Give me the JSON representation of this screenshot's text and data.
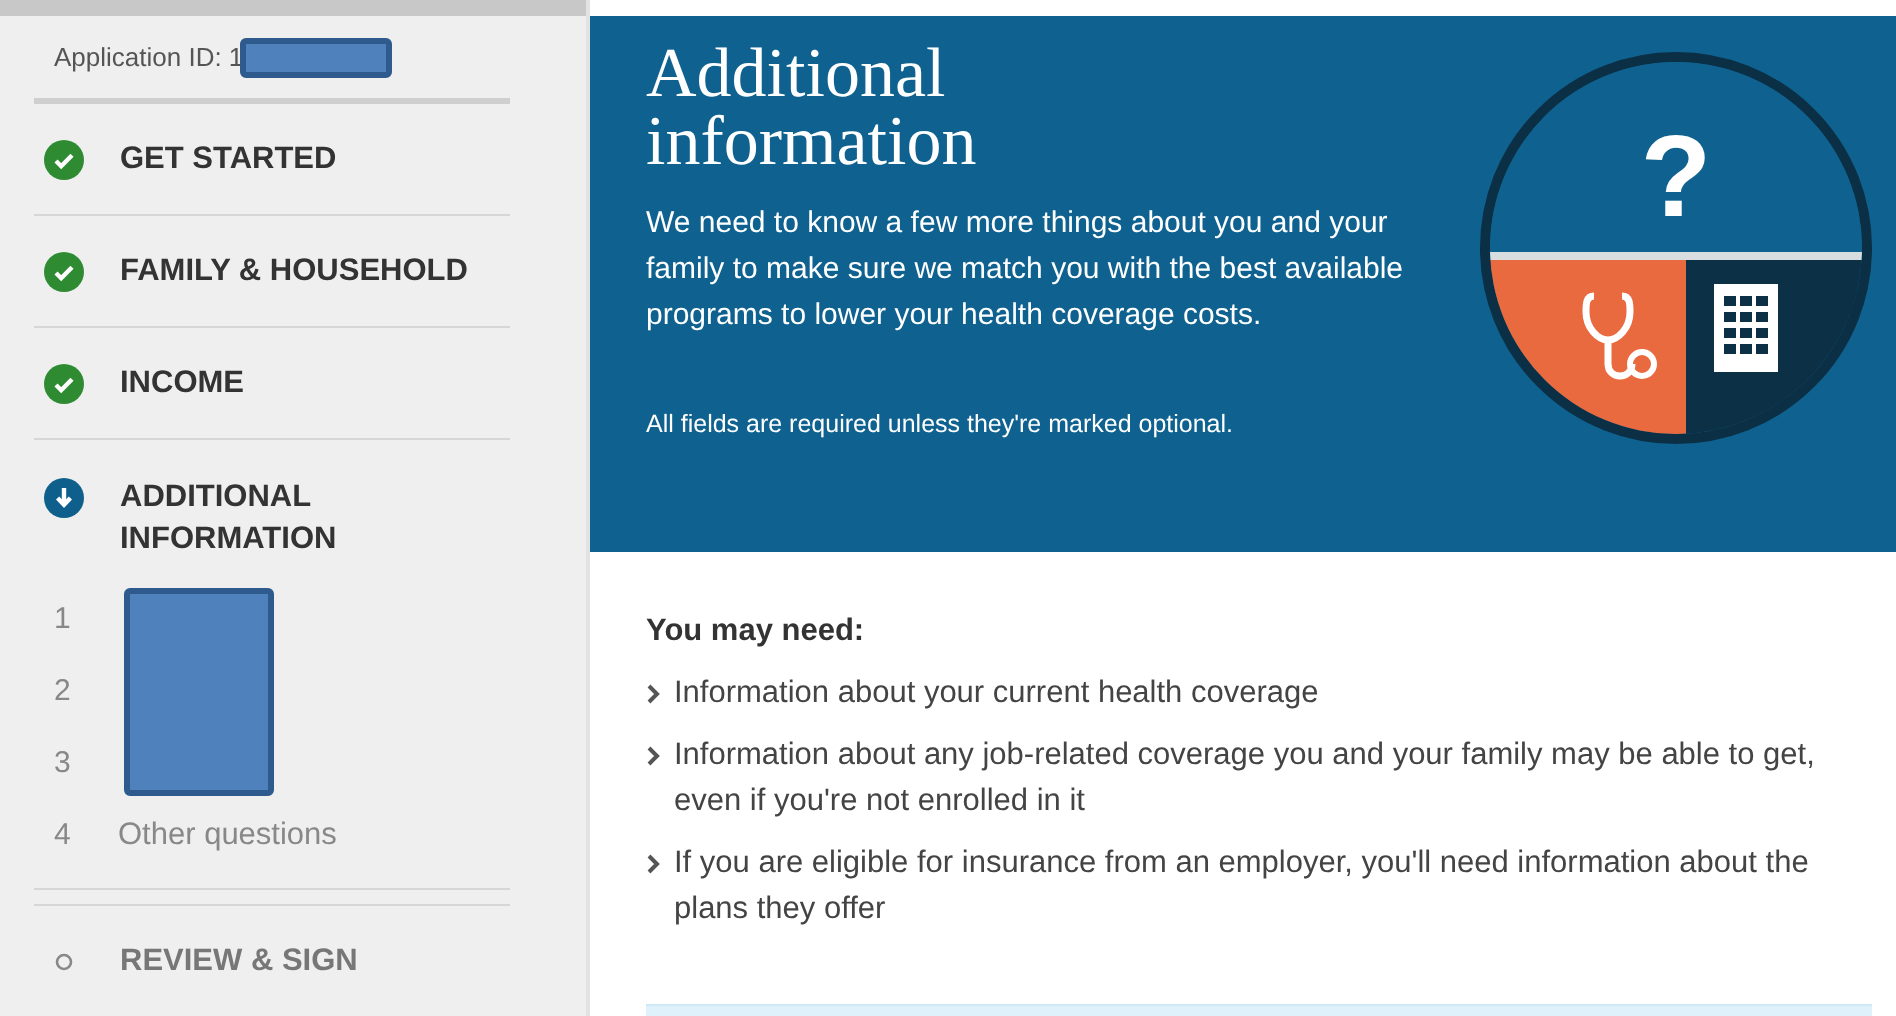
{
  "sidebar": {
    "application_id": {
      "label": "Application ID: 1",
      "redacted": true
    },
    "steps": [
      {
        "label": "GET STARTED",
        "completed": true,
        "current": false
      },
      {
        "label": "FAMILY & HOUSEHOLD",
        "completed": true,
        "current": false
      },
      {
        "label": "INCOME",
        "completed": true,
        "current": false
      },
      {
        "label": "ADDITIONAL INFORMATION",
        "completed": false,
        "current": true,
        "substeps": [
          {
            "number": "1",
            "redacted": true
          },
          {
            "number": "2",
            "redacted": true
          },
          {
            "number": "3",
            "redacted": true
          },
          {
            "number": "4",
            "label": "Other questions"
          }
        ]
      },
      {
        "label": "REVIEW & SIGN",
        "completed": false,
        "current": false
      }
    ]
  },
  "header": {
    "title": "Additional information",
    "description": "We need to know a few more things about you and your family to make sure we match you with the best available programs to lower your health coverage costs.",
    "note": "All fields are required unless they're marked optional.",
    "badge_symbol": "?"
  },
  "content": {
    "heading": "You may need:",
    "items": [
      "Information about your current health coverage",
      "Information about any job-related coverage you and your family may be able to get, even if you're not enrolled in it",
      "If you are eligible for insurance from an employer, you'll need information about the plans they offer"
    ]
  }
}
